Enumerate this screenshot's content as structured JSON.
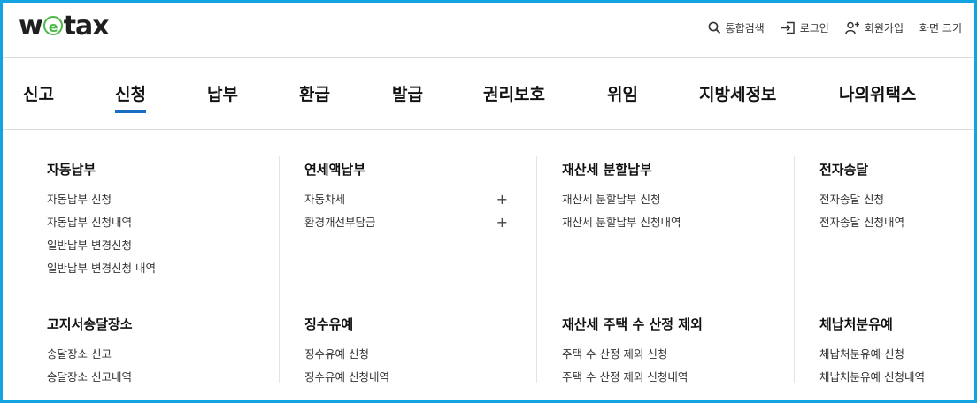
{
  "logo": {
    "before": "w",
    "e": "e",
    "after": "tax"
  },
  "utility": {
    "search": "통합검색",
    "login": "로그인",
    "signup": "회원가입",
    "screen_size": "화면 크기"
  },
  "nav": [
    "신고",
    "신청",
    "납부",
    "환급",
    "발급",
    "권리보호",
    "위임",
    "지방세정보",
    "나의위택스"
  ],
  "active_nav": "신청",
  "accent_color": "#1a6fc2",
  "frame_color": "#12a3e0",
  "menu": {
    "g1": {
      "title": "자동납부",
      "links": [
        "자동납부 신청",
        "자동납부 신청내역",
        "일반납부 변경신청",
        "일반납부 변경신청 내역"
      ]
    },
    "g2": {
      "title": "연세액납부",
      "links": [
        "자동차세",
        "환경개선부담금"
      ],
      "expand": "+"
    },
    "g3": {
      "title": "재산세 분할납부",
      "links": [
        "재산세 분할납부 신청",
        "재산세 분할납부 신청내역"
      ]
    },
    "g4": {
      "title": "전자송달",
      "links": [
        "전자송달 신청",
        "전자송달 신청내역"
      ]
    },
    "g5": {
      "title": "고지서송달장소",
      "links": [
        "송달장소 신고",
        "송달장소 신고내역"
      ]
    },
    "g6": {
      "title": "징수유예",
      "links": [
        "징수유예 신청",
        "징수유예 신청내역"
      ]
    },
    "g7": {
      "title": "재산세 주택 수 산정 제외",
      "links": [
        "주택 수 산정 제외 신청",
        "주택 수 산정 제외 신청내역"
      ]
    },
    "g8": {
      "title": "체납처분유예",
      "links": [
        "체납처분유예 신청",
        "체납처분유예 신청내역"
      ]
    }
  }
}
